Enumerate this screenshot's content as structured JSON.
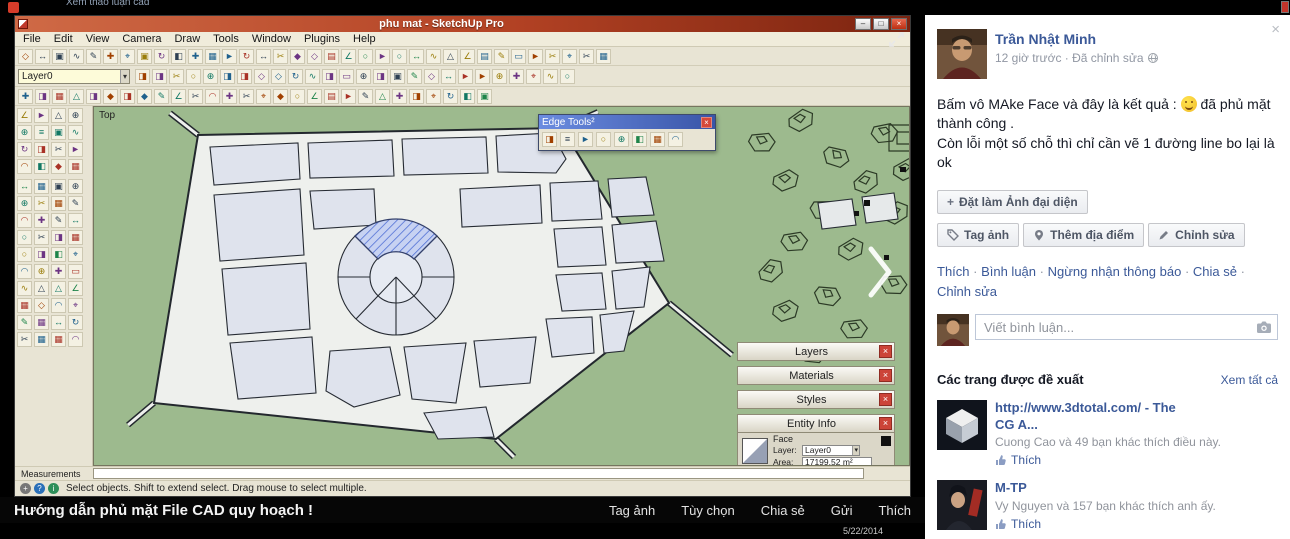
{
  "page": {
    "top_hint": "Xem thảo luận cad"
  },
  "glyphs": {
    "minimize": "–",
    "maximize": "□",
    "close": "×",
    "dropdown": "▾"
  },
  "sketchup": {
    "window_title": "phu mat - SketchUp Pro",
    "menu_items": [
      "File",
      "Edit",
      "View",
      "Camera",
      "Draw",
      "Tools",
      "Window",
      "Plugins",
      "Help"
    ],
    "layer_dropdown_value": "Layer0",
    "viewport_label": "Top",
    "toolbar_row1_icons": [
      "select",
      "line",
      "rectangle",
      "circle",
      "arc",
      "polygon",
      "freehand",
      "eraser",
      "tape-measure",
      "paint-bucket",
      "move",
      "push-pull",
      "rotate",
      "follow-me",
      "scale",
      "offset",
      "text",
      "dimension",
      "protractor",
      "axes",
      "section-plane",
      "orbit",
      "pan",
      "zoom",
      "zoom-window",
      "zoom-extents",
      "previous-view",
      "next-view",
      "position-camera",
      "look-around",
      "walk",
      "make-component",
      "make-group",
      "undo",
      "redo"
    ],
    "toolbar_row2_icons": [
      "layers-manager",
      "add-layer",
      "x-ray",
      "back-edges",
      "wireframe",
      "hidden-line",
      "shaded",
      "shaded-textures",
      "monochrome",
      "shadows",
      "shadow-settings",
      "fog",
      "iso-view",
      "top-view",
      "front-view",
      "right-view",
      "back-view",
      "left-view",
      "explode",
      "intersect-faces",
      "flip-along",
      "purge-unused",
      "model-info",
      "preferences",
      "match-photo",
      "instructor"
    ],
    "toolbar_row3_icons": [
      "import-cad",
      "make-face",
      "edge-tools",
      "bezier-curve",
      "sandbox-contours",
      "sandbox-scratch",
      "smoove",
      "stamp",
      "drape",
      "add-detail",
      "flip-edge",
      "joint-push-pull",
      "vector-push-pull",
      "normal-push-pull",
      "round-corner",
      "curviloft",
      "solid-union",
      "solid-subtract",
      "solid-trim",
      "solid-intersect",
      "outer-shell",
      "weld-edges",
      "split-tool",
      "soap-skin",
      "mirror",
      "copy-along-path",
      "component-spray",
      "tools-on-surface"
    ],
    "left_toolbar_icons": [
      "select-tool",
      "component-browser",
      "materials-browser",
      "styles-browser",
      "line-tool",
      "rectangle-tool",
      "circle-tool",
      "arc-tool",
      "polygon-tool",
      "freehand-tool",
      "move-tool",
      "rotate-tool",
      "scale-tool",
      "push-pull-tool",
      "follow-me-tool",
      "offset-tool"
    ],
    "left_toolbar_icons2": [
      "tape-tool",
      "protractor-tool",
      "axes-tool",
      "dimension-tool",
      "text-tool",
      "3d-text-tool",
      "section-tool",
      "orbit-tool",
      "pan-tool",
      "zoom-tool",
      "zoom-extents-tool",
      "position-camera-tool",
      "walk-tool",
      "look-around-tool",
      "paint-tool",
      "eraser-tool",
      "fredo-scale",
      "round-corner-tool",
      "bezier-tool",
      "weld-tool",
      "curviloft-tool",
      "extrude-tool",
      "drape-tool",
      "joint-pushpull-tool",
      "mirror-tool",
      "shape-bender",
      "flowify",
      "truebend",
      "vertex-tools",
      "quad-face-tools",
      "clean-up",
      "solid-inspector",
      "material-replacer",
      "loft-tool",
      "profile-builder",
      "path-copy",
      "rotate-copy",
      "solar-north",
      "slicer",
      "artisan"
    ],
    "edge_tools": {
      "title": "Edge Tools²",
      "icons": [
        "simplify-edges",
        "bezier-edges",
        "smooth-edges",
        "weld-edges",
        "find-gaps",
        "close-gaps",
        "extend-edges",
        "flatten-edges"
      ]
    },
    "panels": {
      "collapsed": [
        "Layers",
        "Materials",
        "Styles"
      ],
      "entity_info_title": "Entity Info",
      "entity_info": {
        "type_label": "Face",
        "layer_label": "Layer:",
        "layer_value": "Layer0",
        "area_label": "Area:",
        "area_value": "17199.52 m²"
      }
    },
    "measurements_label": "Measurements",
    "status_text": "Select objects. Shift to extend select. Drag mouse to select multiple."
  },
  "photo": {
    "caption": "Hướng dẫn phủ mặt File CAD quy hoạch !",
    "actions": [
      "Tag ảnh",
      "Tùy chọn",
      "Chia sẻ",
      "Gửi",
      "Thích"
    ],
    "date": "5/22/2014"
  },
  "facebook": {
    "author": "Trần Nhật Minh",
    "meta": "12 giờ trước · Đã chỉnh sửa",
    "post": {
      "line1_before": "Bấm vô MAke Face và đây là kết quả :",
      "line1_after": "đã phủ mặt thành công .",
      "line2": "Còn lỗi một số chỗ thì chỉ cần vẽ 1 đường line bo lại là ok"
    },
    "profile_button": "Đặt làm Ảnh đại diện",
    "action_buttons": [
      "Tag ảnh",
      "Thêm địa điểm",
      "Chỉnh sửa"
    ],
    "links": [
      "Thích",
      "Bình luận",
      "Ngừng nhận thông báo",
      "Chia sẻ",
      "Chỉnh sửa"
    ],
    "comment_placeholder": "Viết bình luận...",
    "suggested": {
      "header": "Các trang được đề xuất",
      "see_all": "Xem tất cả",
      "items": [
        {
          "name": "http://www.3dtotal.com/ - The CG A...",
          "social": "Cuong Cao và 49 bạn khác thích điều này.",
          "like": "Thích"
        },
        {
          "name": "M-TP",
          "social": "Vy Nguyen và 157 bạn khác thích anh ấy.",
          "like": "Thích"
        }
      ]
    }
  }
}
